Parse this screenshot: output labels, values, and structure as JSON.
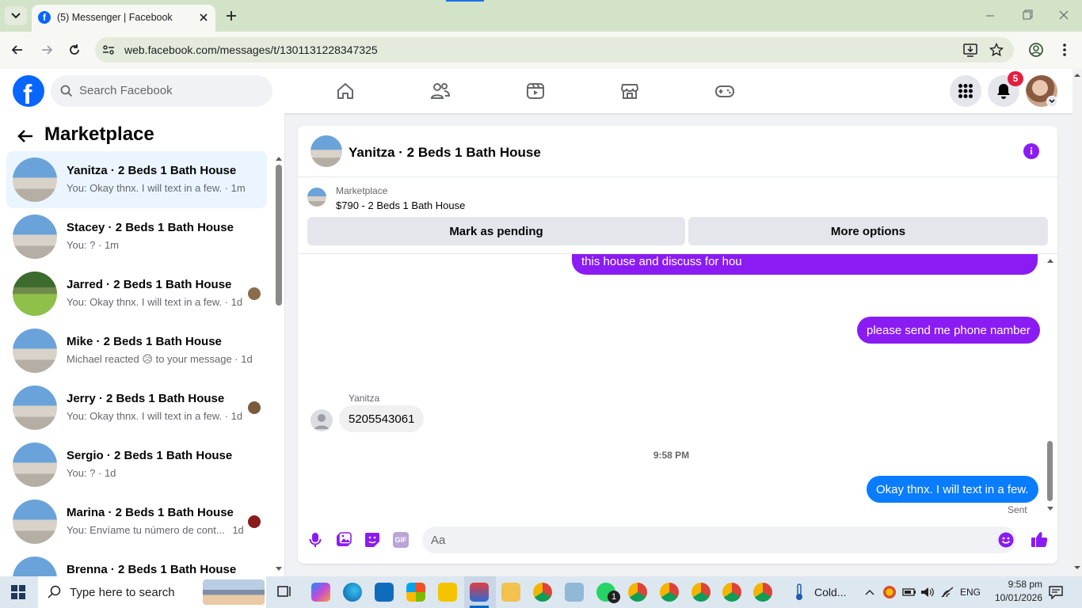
{
  "browser": {
    "tab_title": "(5) Messenger | Facebook",
    "url": "web.facebook.com/messages/t/1301131228347325"
  },
  "fb": {
    "search_placeholder": "Search Facebook",
    "notification_count": "5",
    "nav_icons": [
      "home-icon",
      "friends-icon",
      "video-icon",
      "marketplace-icon",
      "gaming-icon"
    ],
    "brand_color": "#0866ff"
  },
  "sidebar": {
    "title": "Marketplace",
    "conversations": [
      {
        "name": "Yanitza · 2 Beds 1 Bath House",
        "snippet": "You: Okay thnx. I will text in a few. · 1m",
        "active": true
      },
      {
        "name": "Stacey · 2 Beds 1 Bath House",
        "snippet": "You: ? · 1m"
      },
      {
        "name": "Jarred · 2 Beds 1 Bath House",
        "snippet": "You: Okay thnx. I will text in a few. · 1d"
      },
      {
        "name": "Mike · 2 Beds 1 Bath House",
        "snippet_pre": "Michael reacted",
        "snippet_emoji": "😥",
        "snippet_post": "to your message · 1d"
      },
      {
        "name": "Jerry · 2 Beds 1 Bath House",
        "snippet": "You: Okay thnx. I will text in a few. · 1d"
      },
      {
        "name": "Sergio · 2 Beds 1 Bath House",
        "snippet": "You: ? · 1d"
      },
      {
        "name": "Marina · 2 Beds 1 Bath House",
        "snippet": "You: Envíame tu número de cont...",
        "time": "1d"
      },
      {
        "name": "Brenna · 2 Beds 1 Bath House",
        "snippet": ""
      }
    ]
  },
  "chat": {
    "title": "Yanitza · 2 Beds 1 Bath House",
    "listing_source": "Marketplace",
    "listing_title": "$790 - 2 Beds 1 Bath House",
    "mark_pending_label": "Mark as pending",
    "more_options_label": "More options",
    "messages": [
      {
        "text": "this house and discuss for hou",
        "direction": "out"
      },
      {
        "text": "please send me phone namber",
        "direction": "out"
      },
      {
        "sender": "Yanitza",
        "text": "5205543061",
        "direction": "in"
      },
      {
        "timestamp": "9:58 PM"
      },
      {
        "text": "Okay thnx. I will text in a few.",
        "direction": "out",
        "status": "Sent"
      }
    ],
    "composer_placeholder": "Aa",
    "accent_color": "#8a1cf3",
    "outgoing_blue": "#0a7cff"
  },
  "taskbar": {
    "search_placeholder": "Type here to search",
    "weather": "Cold...",
    "language": "ENG",
    "time": "9:58 pm",
    "date": "10/01/2026",
    "whatsapp_badge": "1"
  }
}
